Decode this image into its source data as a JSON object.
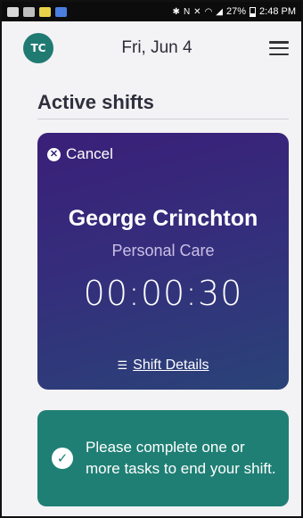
{
  "status_bar": {
    "time": "2:48 PM",
    "battery": "27%",
    "icons": [
      "gallery-icon",
      "signal-chat-icon",
      "bitmoji-icon",
      "app-icon",
      "bluetooth-icon",
      "nfc-icon",
      "mute-icon",
      "wifi-icon",
      "signal-icon",
      "battery-icon"
    ]
  },
  "header": {
    "avatar_initials": "TC",
    "date": "Fri, Jun 4"
  },
  "section": {
    "title": "Active shifts"
  },
  "shift_card": {
    "cancel_label": "Cancel",
    "worker_name": "George Crinchton",
    "service": "Personal Care",
    "timer": "00:00:30",
    "details_label": "Shift Details"
  },
  "notice": {
    "text": "Please complete one or more tasks to end your shift."
  },
  "colors": {
    "avatar": "#1f7a72",
    "card_gradient_start": "#3a1f78",
    "card_gradient_end": "#2a4378",
    "notice": "#1f7f74"
  }
}
